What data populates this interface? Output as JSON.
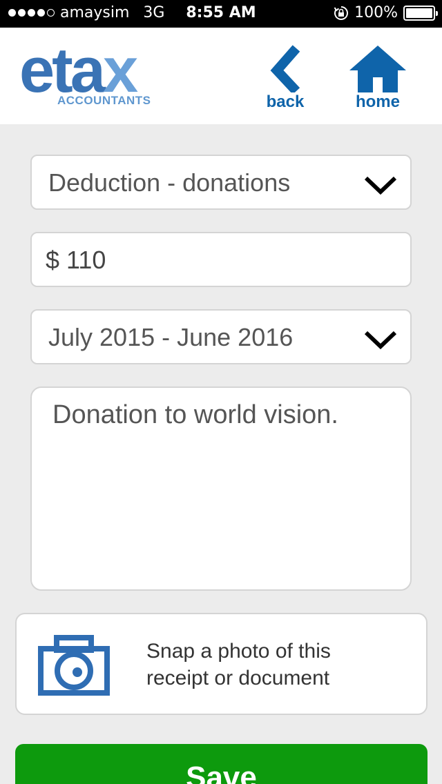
{
  "status_bar": {
    "carrier": "amaysim",
    "network": "3G",
    "time": "8:55 AM",
    "battery": "100%",
    "signal_bars_filled": 4,
    "signal_bars_total": 5
  },
  "header": {
    "logo_word": "etax",
    "logo_sub": "ACCOUNTANTS",
    "back_label": "back",
    "home_label": "home"
  },
  "form": {
    "category": "Deduction - donations",
    "amount": "$ 110",
    "period": "July 2015 - June 2016",
    "notes": "Donation to world vision.",
    "photo_label_line1": "Snap a photo of this",
    "photo_label_line2": "receipt or document",
    "save_label": "Save"
  },
  "colors": {
    "brand_blue": "#0f64aa",
    "logo_blue": "#3a73b5",
    "save_green": "#0d9a0d",
    "background": "#ececec"
  },
  "icons": [
    "chevron-down-icon",
    "back-arrow-icon",
    "home-icon",
    "camera-icon",
    "rotation-lock-icon",
    "battery-icon"
  ]
}
